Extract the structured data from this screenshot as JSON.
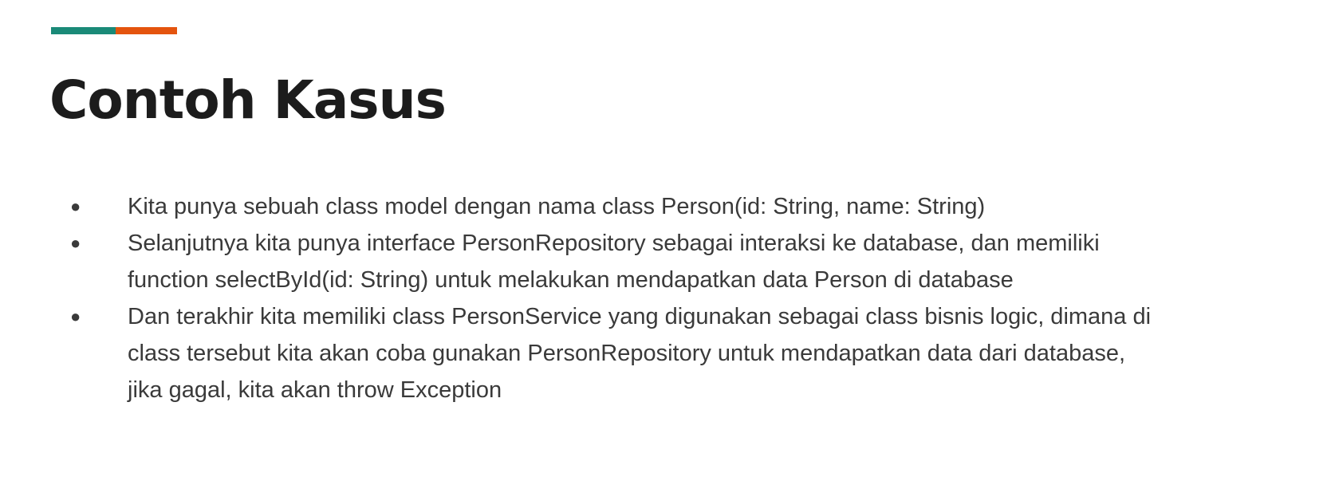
{
  "slide": {
    "title": "Contoh Kasus",
    "accent_colors": {
      "teal": "#1a8a78",
      "orange": "#e4540e"
    },
    "bullets": [
      {
        "marker": "●",
        "text": "Kita punya sebuah class model dengan nama class Person(id: String, name: String)"
      },
      {
        "marker": "●",
        "text": "Selanjutnya kita punya interface PersonRepository sebagai interaksi ke database, dan memiliki\nfunction selectById(id: String) untuk melakukan mendapatkan data Person di database"
      },
      {
        "marker": "●",
        "text": "Dan terakhir kita memiliki class PersonService yang digunakan sebagai class bisnis logic, dimana di\nclass tersebut kita akan coba gunakan PersonRepository untuk mendapatkan data dari database,\njika gagal, kita akan throw Exception"
      }
    ]
  }
}
